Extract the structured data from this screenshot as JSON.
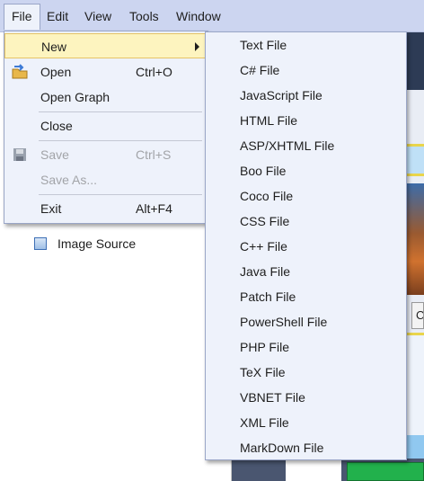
{
  "menubar": {
    "items": [
      "File",
      "Edit",
      "View",
      "Tools",
      "Window"
    ]
  },
  "file_menu": {
    "new_label": "New",
    "open_label": "Open",
    "open_shortcut": "Ctrl+O",
    "open_graph_label": "Open Graph",
    "close_label": "Close",
    "save_label": "Save",
    "save_shortcut": "Ctrl+S",
    "save_as_label": "Save As...",
    "exit_label": "Exit",
    "exit_shortcut": "Alt+F4"
  },
  "new_submenu": {
    "items": [
      "Text File",
      "C# File",
      "JavaScript File",
      "HTML File",
      "ASP/XHTML File",
      "Boo File",
      "Coco File",
      "CSS File",
      "C++ File",
      "Java File",
      "Patch File",
      "PowerShell File",
      "PHP File",
      "TeX File",
      "VBNET File",
      "XML File",
      "MarkDown File"
    ]
  },
  "tree": {
    "image_source_label": "Image Source"
  },
  "canvas": {
    "clipped_button_text": "C"
  },
  "colors": {
    "menubar": "#ccd5f0",
    "menu_bg": "#eef2fb",
    "highlight": "#fdf4bf",
    "disabled_text": "#a2a4a8"
  }
}
